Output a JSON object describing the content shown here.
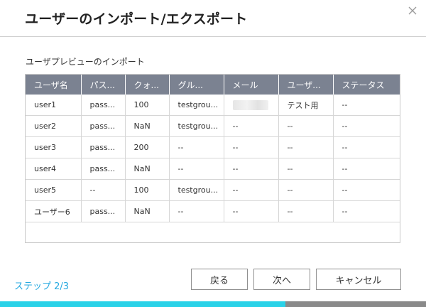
{
  "dialog": {
    "title": "ユーザーのインポート/エクスポート",
    "section_label": "ユーザプレビューのインポート"
  },
  "table": {
    "columns": [
      "ユーザ名",
      "パス...",
      "クォ...",
      "グル...",
      "メール",
      "ユーザ...",
      "ステータス"
    ],
    "rows": [
      [
        "user1",
        "pass...",
        "100",
        "testgrou...",
        "",
        "テスト用",
        "--"
      ],
      [
        "user2",
        "pass...",
        "NaN",
        "testgrou...",
        "--",
        "--",
        "--"
      ],
      [
        "user3",
        "pass...",
        "200",
        "--",
        "--",
        "--",
        "--"
      ],
      [
        "user4",
        "pass...",
        "NaN",
        "--",
        "--",
        "--",
        "--"
      ],
      [
        "user5",
        "--",
        "100",
        "testgrou...",
        "--",
        "--",
        "--"
      ],
      [
        "ユーザー6",
        "pass...",
        "NaN",
        "--",
        "--",
        "--",
        "--"
      ]
    ]
  },
  "footer": {
    "step_text": "ステップ 2/3",
    "back_label": "戻る",
    "next_label": "次へ",
    "cancel_label": "キャンセル"
  },
  "progress": {
    "fraction": 0.67
  },
  "colors": {
    "accent": "#26a9e0",
    "progress_fill": "#2ad2e8",
    "progress_track": "#8a8a8a",
    "header_bg": "#7b8291"
  },
  "icons": {
    "close": "close-icon"
  }
}
